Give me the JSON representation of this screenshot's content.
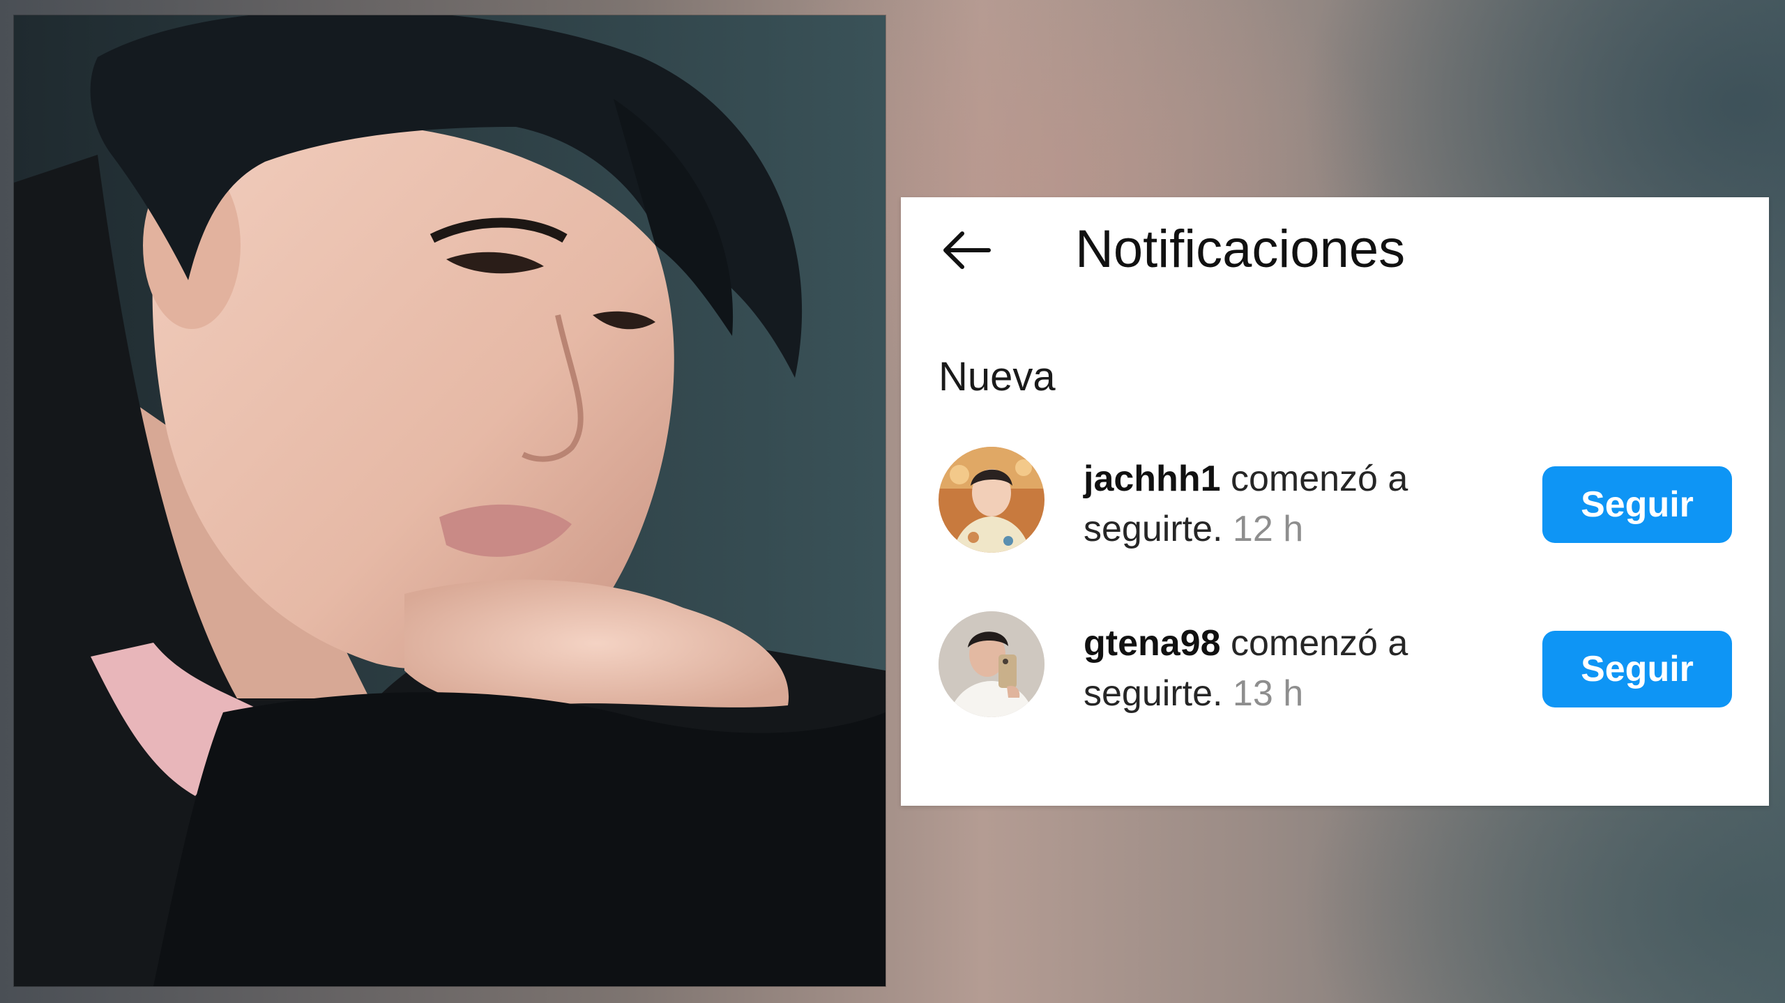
{
  "panel": {
    "back_icon": "arrow-left-icon",
    "title": "Notificaciones",
    "section_label": "Nueva"
  },
  "notifications": [
    {
      "username": "jachhh1",
      "action": "comenzó a seguirte.",
      "time": "12 h",
      "button_label": "Seguir",
      "avatar_icon": "user-avatar"
    },
    {
      "username": "gtena98",
      "action": "comenzó a seguirte.",
      "time": "13 h",
      "button_label": "Seguir",
      "avatar_icon": "user-avatar"
    }
  ],
  "colors": {
    "button_blue": "#0e95f5",
    "time_gray": "#8e8e8e",
    "text_dark": "#111111"
  }
}
